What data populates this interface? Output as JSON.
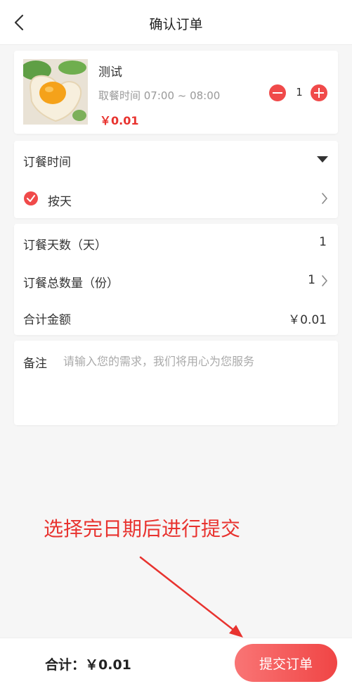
{
  "header": {
    "title": "确认订单"
  },
  "product": {
    "name": "测试",
    "pickup_time": "取餐时间 07:00 ~ 08:00",
    "price": "￥0.01",
    "quantity": "1"
  },
  "order_time": {
    "label": "订餐时间",
    "option_label": "按天"
  },
  "summary": {
    "days_label": "订餐天数（天）",
    "days_value": "1",
    "count_label": "订餐总数量（份）",
    "count_value": "1",
    "amount_label": "合计金额",
    "amount_value": "￥0.01"
  },
  "note": {
    "label": "备注",
    "placeholder": "请输入您的需求，我们将用心为您服务"
  },
  "annotation": {
    "text": "选择完日期后进行提交"
  },
  "footer": {
    "total_label": "合计：",
    "total_value": "￥0.01",
    "submit_label": "提交订单"
  },
  "colors": {
    "accent": "#f04a4a",
    "price": "#e8332f"
  },
  "icons": [
    "back-arrow-icon",
    "minus-circle-icon",
    "plus-circle-icon",
    "caret-down-icon",
    "check-circle-icon",
    "chevron-right-icon"
  ]
}
